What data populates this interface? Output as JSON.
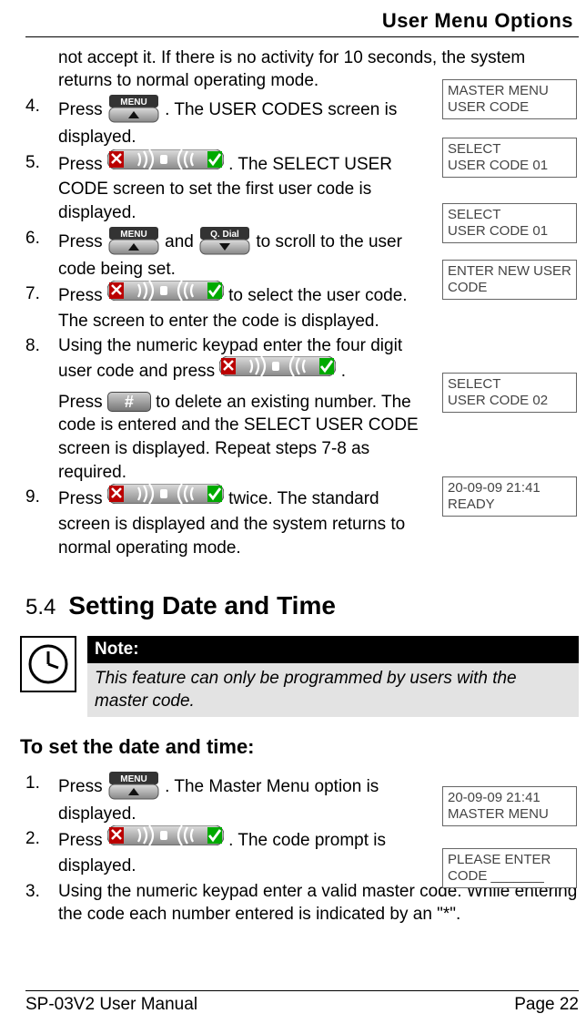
{
  "header": {
    "title": "User Menu Options"
  },
  "continued_text": "not accept it. If there is no activity for 10 seconds, the system returns to normal operating mode.",
  "steps_a": [
    {
      "num": "4.",
      "pre": "Press ",
      "post": ". The USER CODES screen is displayed.",
      "icons": [
        "menu"
      ]
    },
    {
      "num": "5.",
      "pre": "Press ",
      "post": ". The SELECT USER CODE screen to set the first user code is displayed.",
      "icons": [
        "tri-green"
      ]
    },
    {
      "num": "6.",
      "pre": "Press ",
      "mid": " and ",
      "post": " to scroll to the user code being set.",
      "icons": [
        "menu",
        "qdial"
      ]
    },
    {
      "num": "7.",
      "pre": "Press ",
      "post": " to select the user code. The screen to enter the code is displayed.",
      "icons": [
        "tri-green"
      ]
    },
    {
      "num": "8.",
      "line1_pre": "Using the numeric keypad enter the four digit user code and press ",
      "line1_post": ".",
      "line2_pre": "Press ",
      "line2_post": " to delete an existing number. The code is entered and the SELECT USER CODE screen is displayed. Repeat steps 7-8 as required.",
      "icons": [
        "tri-green",
        "hash"
      ]
    },
    {
      "num": "9.",
      "pre": "Press ",
      "post": " twice. The standard screen is displayed and the system returns to normal operating mode.",
      "icons": [
        "tri-red"
      ]
    }
  ],
  "section": {
    "num": "5.4",
    "title": "Setting Date and Time"
  },
  "note": {
    "head": "Note:",
    "body": "This feature can only be programmed by users with the master code."
  },
  "procedure_title": "To set the date and time:",
  "steps_b": [
    {
      "num": "1.",
      "pre": "Press ",
      "post": ". The Master Menu option is displayed.",
      "icons": [
        "menu"
      ]
    },
    {
      "num": "2.",
      "pre": "Press ",
      "post": ". The code prompt is displayed.",
      "icons": [
        "tri-green"
      ]
    },
    {
      "num": "3.",
      "text": "Using the numeric keypad enter a valid master code. While entering the code each number entered is indicated by an \"*\"."
    }
  ],
  "screens": [
    {
      "l1": "MASTER MENU",
      "l2": "USER CODE"
    },
    {
      "l1": "SELECT",
      "l2": "USER CODE 01"
    },
    {
      "l1": "SELECT",
      "l2": "USER CODE 01"
    },
    {
      "l1": "ENTER NEW USER",
      "l2": "CODE"
    },
    {
      "l1": "SELECT",
      "l2": "USER CODE 02"
    },
    {
      "l1": "20-09-09  21:41",
      "l2": "READY"
    },
    {
      "l1": "20-09-09 21:41",
      "l2": "MASTER MENU"
    },
    {
      "l1": "PLEASE ENTER",
      "l2": "CODE _______"
    }
  ],
  "footer": {
    "left": "SP-03V2 User Manual",
    "right": "Page 22"
  }
}
